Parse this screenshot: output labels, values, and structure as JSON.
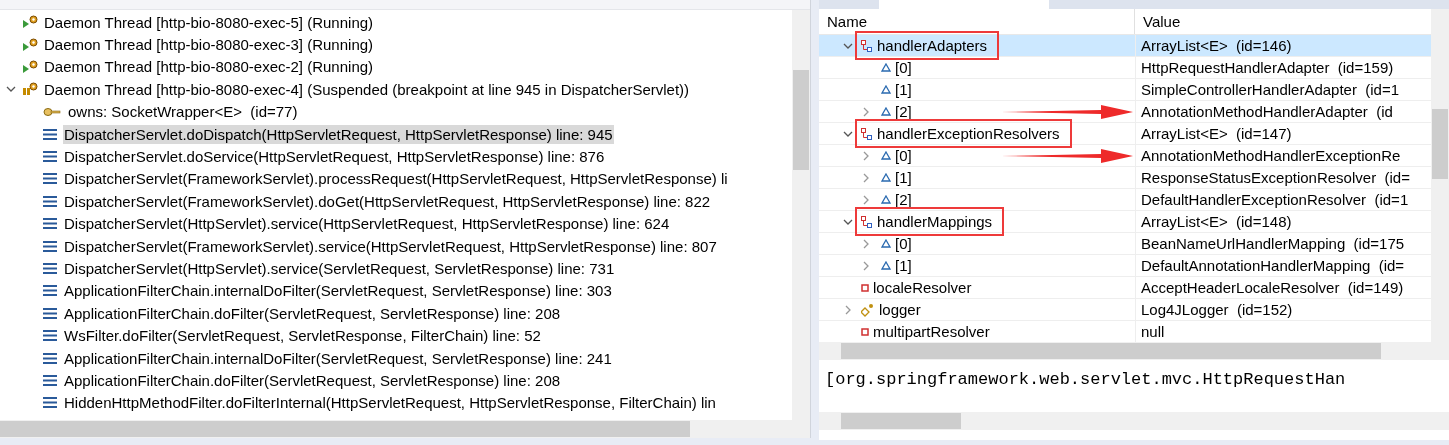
{
  "debug_tree": {
    "items": [
      {
        "kind": "thread",
        "label": "Daemon Thread [http-bio-8080-exec-5] (Running)",
        "suspended": false
      },
      {
        "kind": "thread",
        "label": "Daemon Thread [http-bio-8080-exec-3] (Running)",
        "suspended": false
      },
      {
        "kind": "thread",
        "label": "Daemon Thread [http-bio-8080-exec-2] (Running)",
        "suspended": false
      },
      {
        "kind": "thread",
        "label": "Daemon Thread [http-bio-8080-exec-4] (Suspended (breakpoint at line 945 in DispatcherServlet))",
        "suspended": true,
        "expanded": true,
        "children": [
          {
            "kind": "monitor",
            "label": "owns: SocketWrapper<E>  (id=77)",
            "selected": false
          },
          {
            "kind": "frame",
            "label": "DispatcherServlet.doDispatch(HttpServletRequest, HttpServletResponse) line: 945",
            "selected": true
          },
          {
            "kind": "frame",
            "label": "DispatcherServlet.doService(HttpServletRequest, HttpServletResponse) line: 876",
            "selected": false
          },
          {
            "kind": "frame",
            "label": "DispatcherServlet(FrameworkServlet).processRequest(HttpServletRequest, HttpServletResponse) li",
            "selected": false
          },
          {
            "kind": "frame",
            "label": "DispatcherServlet(FrameworkServlet).doGet(HttpServletRequest, HttpServletResponse) line: 822",
            "selected": false
          },
          {
            "kind": "frame",
            "label": "DispatcherServlet(HttpServlet).service(HttpServletRequest, HttpServletResponse) line: 624",
            "selected": false
          },
          {
            "kind": "frame",
            "label": "DispatcherServlet(FrameworkServlet).service(HttpServletRequest, HttpServletResponse) line: 807",
            "selected": false
          },
          {
            "kind": "frame",
            "label": "DispatcherServlet(HttpServlet).service(ServletRequest, ServletResponse) line: 731",
            "selected": false
          },
          {
            "kind": "frame",
            "label": "ApplicationFilterChain.internalDoFilter(ServletRequest, ServletResponse) line: 303",
            "selected": false
          },
          {
            "kind": "frame",
            "label": "ApplicationFilterChain.doFilter(ServletRequest, ServletResponse) line: 208",
            "selected": false
          },
          {
            "kind": "frame",
            "label": "WsFilter.doFilter(ServletRequest, ServletResponse, FilterChain) line: 52",
            "selected": false
          },
          {
            "kind": "frame",
            "label": "ApplicationFilterChain.internalDoFilter(ServletRequest, ServletResponse) line: 241",
            "selected": false
          },
          {
            "kind": "frame",
            "label": "ApplicationFilterChain.doFilter(ServletRequest, ServletResponse) line: 208",
            "selected": false
          },
          {
            "kind": "frame",
            "label": "HiddenHttpMethodFilter.doFilterInternal(HttpServletRequest, HttpServletResponse, FilterChain) lin",
            "selected": false
          }
        ]
      }
    ]
  },
  "variables": {
    "columns": [
      "Name",
      "Value"
    ],
    "rows": [
      {
        "kind": "list",
        "name": "handlerAdapters",
        "value": "ArrayList<E>  (id=146)",
        "expanded": true,
        "selected": true,
        "highlighted": true,
        "children": [
          {
            "kind": "element",
            "name": "[0]",
            "value": "HttpRequestHandlerAdapter  (id=159)",
            "selected": false
          },
          {
            "kind": "element",
            "name": "[1]",
            "value": "SimpleControllerHandlerAdapter  (id=1",
            "selected": false
          },
          {
            "kind": "element",
            "name": "[2]",
            "value": "AnnotationMethodHandlerAdapter  (id",
            "expanded": false,
            "selected": false,
            "arrow": true
          }
        ]
      },
      {
        "kind": "list",
        "name": "handlerExceptionResolvers",
        "value": "ArrayList<E>  (id=147)",
        "expanded": true,
        "selected": false,
        "highlighted": true,
        "children": [
          {
            "kind": "element",
            "name": "[0]",
            "value": "AnnotationMethodHandlerExceptionRe",
            "expanded": false,
            "selected": false,
            "arrow": true
          },
          {
            "kind": "element",
            "name": "[1]",
            "value": "ResponseStatusExceptionResolver  (id=",
            "expanded": false,
            "selected": false
          },
          {
            "kind": "element",
            "name": "[2]",
            "value": "DefaultHandlerExceptionResolver  (id=1",
            "expanded": false,
            "selected": false
          }
        ]
      },
      {
        "kind": "list",
        "name": "handlerMappings",
        "value": "ArrayList<E>  (id=148)",
        "expanded": true,
        "selected": false,
        "highlighted": true,
        "children": [
          {
            "kind": "element",
            "name": "[0]",
            "value": "BeanNameUrlHandlerMapping  (id=175",
            "expanded": false,
            "selected": false
          },
          {
            "kind": "element",
            "name": "[1]",
            "value": "DefaultAnnotationHandlerMapping  (id=",
            "expanded": false,
            "selected": false
          }
        ]
      },
      {
        "kind": "field",
        "name": "localeResolver",
        "value": "AcceptHeaderLocaleResolver  (id=149)",
        "selected": false
      },
      {
        "kind": "static",
        "name": "logger",
        "value": "Log4JLogger  (id=152)",
        "expanded": false,
        "selected": false
      },
      {
        "kind": "field",
        "name": "multipartResolver",
        "value": "null",
        "selected": false
      }
    ],
    "detail": "[org.springframework.web.servlet.mvc.HttpRequestHan"
  }
}
